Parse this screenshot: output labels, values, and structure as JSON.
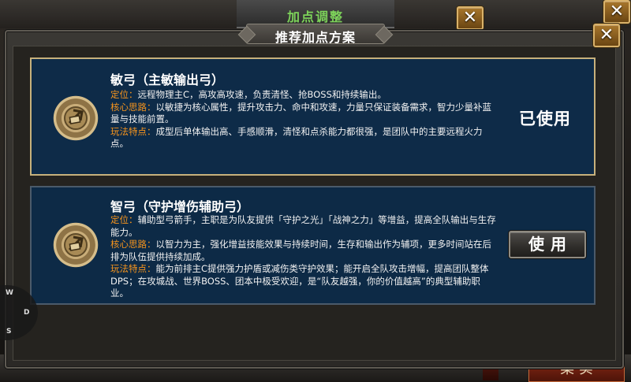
{
  "background": {
    "title": "加点调整",
    "bottom_button": "菜 实"
  },
  "dialog": {
    "title": "推荐加点方案"
  },
  "cards": [
    {
      "heading": "敏弓（主敏输出弓）",
      "rows": [
        {
          "label": "定位：",
          "text": "远程物理主C，高攻高攻速，负责清怪、抢BOSS和持续输出。"
        },
        {
          "label": "核心思路：",
          "text": "以敏捷为核心属性，提升攻击力、命中和攻速，力量只保证装备需求，智力少量补蓝量与技能前置。"
        },
        {
          "label": "玩法特点：",
          "text": "成型后单体输出高、手感顺滑，清怪和点杀能力都很强，是团队中的主要远程火力点。"
        }
      ],
      "status": "已使用",
      "active": true
    },
    {
      "heading": "智弓（守护增伤辅助弓）",
      "rows": [
        {
          "label": "定位：",
          "text": "辅助型弓箭手，主职是为队友提供「守护之光」「战神之力」等增益，提高全队输出与生存能力。"
        },
        {
          "label": "核心思路：",
          "text": "以智力为主，强化增益技能效果与持续时间，生存和输出作为辅项，更多时间站在后排为队伍提供持续加成。"
        },
        {
          "label": "玩法特点：",
          "text": "能为前排主C提供强力护盾或减伤类守护效果；能开启全队攻击增幅，提高团队整体DPS；在攻城战、世界BOSS、团本中极受欢迎，是“队友越强，你的价值越高”的典型辅助职业。"
        }
      ],
      "button": "使用",
      "active": false
    }
  ],
  "joystick": {
    "w": "W",
    "d": "D",
    "s": "S"
  },
  "colors": {
    "label_orange": "#f6941d",
    "card_bg": "#0e2b48",
    "active_border": "#c7b17c",
    "bg_title_green": "#7dd35a"
  }
}
